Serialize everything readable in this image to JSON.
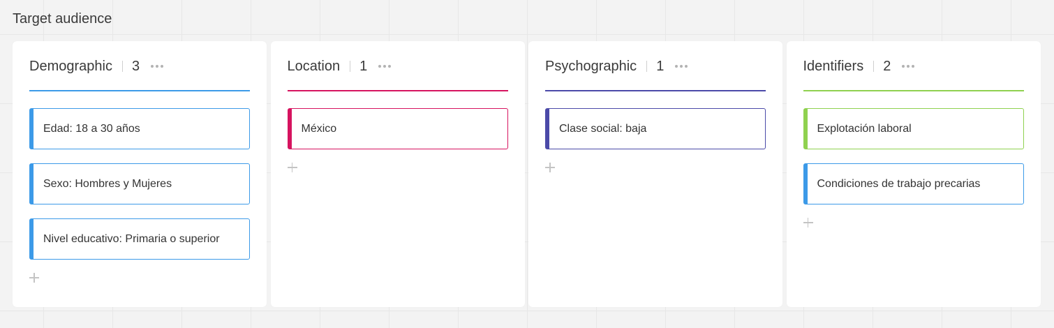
{
  "board": {
    "title": "Target audience"
  },
  "columns": [
    {
      "title": "Demographic",
      "count": "3",
      "color": "#3c9ae8",
      "cards": [
        {
          "text": "Edad: 18 a 30 años",
          "color": "#3c9ae8"
        },
        {
          "text": "Sexo: Hombres y Mujeres",
          "color": "#3c9ae8"
        },
        {
          "text": "Nivel educativo: Primaria o superior",
          "color": "#3c9ae8"
        }
      ]
    },
    {
      "title": "Location",
      "count": "1",
      "color": "#d6135f",
      "cards": [
        {
          "text": "México",
          "color": "#d6135f"
        }
      ]
    },
    {
      "title": "Psychographic",
      "count": "1",
      "color": "#4b4aa8",
      "cards": [
        {
          "text": "Clase social: baja",
          "color": "#4b4aa8"
        }
      ]
    },
    {
      "title": "Identifiers",
      "count": "2",
      "color": "#8fd14f",
      "cards": [
        {
          "text": "Explotación laboral",
          "color": "#8fd14f"
        },
        {
          "text": "Condiciones de trabajo precarias",
          "color": "#3c9ae8"
        }
      ]
    }
  ]
}
